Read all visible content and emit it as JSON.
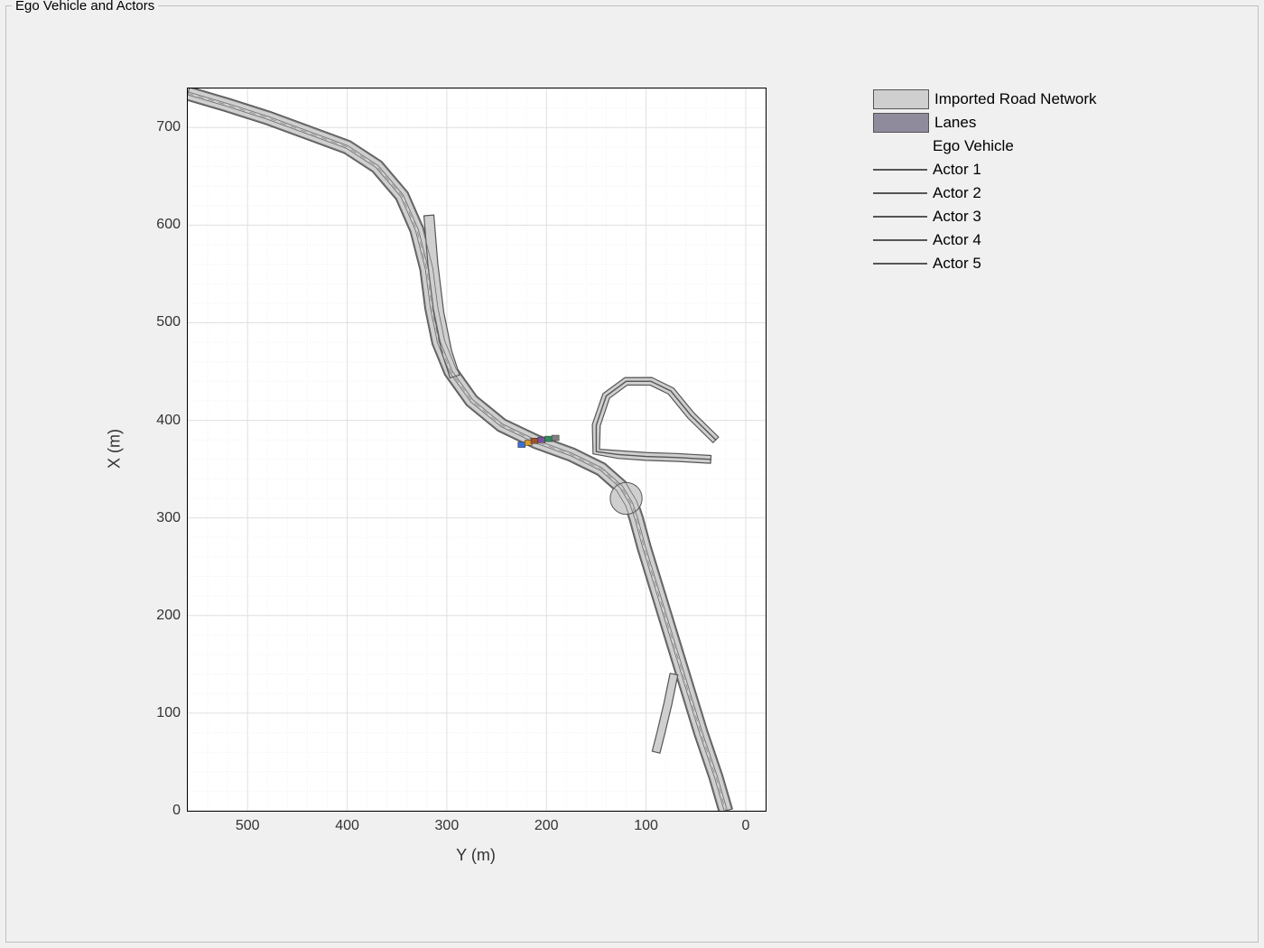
{
  "panel": {
    "title": "Ego Vehicle and Actors"
  },
  "axes": {
    "xlabel": "Y (m)",
    "ylabel": "X (m)",
    "x_ticks": [
      "500",
      "400",
      "300",
      "200",
      "100",
      "0"
    ],
    "y_ticks": [
      "0",
      "100",
      "200",
      "300",
      "400",
      "500",
      "600",
      "700"
    ],
    "x_range_data": [
      560,
      -20
    ],
    "y_range_data": [
      0,
      740
    ]
  },
  "legend": {
    "items": [
      {
        "kind": "swatch",
        "color": "#cfcfcf",
        "label": "Imported Road Network"
      },
      {
        "kind": "swatch",
        "color": "#8f8a9c",
        "label": "Lanes"
      },
      {
        "kind": "empty",
        "label": "Ego Vehicle"
      },
      {
        "kind": "line",
        "color": "#555555",
        "label": "Actor 1"
      },
      {
        "kind": "line",
        "color": "#555555",
        "label": "Actor 2"
      },
      {
        "kind": "line",
        "color": "#555555",
        "label": "Actor 3"
      },
      {
        "kind": "line",
        "color": "#555555",
        "label": "Actor 4"
      },
      {
        "kind": "line",
        "color": "#555555",
        "label": "Actor 5"
      }
    ]
  },
  "chart_data": {
    "type": "map",
    "title": "Ego Vehicle and Actors",
    "xlabel": "Y (m)",
    "ylabel": "X (m)",
    "x_range": [
      560,
      -20
    ],
    "y_range": [
      0,
      740
    ],
    "note": "Y axis (horizontal) is reversed (decreasing to the right).",
    "road_centerline_YX": [
      [
        560,
        735
      ],
      [
        520,
        723
      ],
      [
        480,
        710
      ],
      [
        440,
        695
      ],
      [
        400,
        680
      ],
      [
        370,
        660
      ],
      [
        345,
        630
      ],
      [
        330,
        595
      ],
      [
        320,
        555
      ],
      [
        315,
        515
      ],
      [
        308,
        480
      ],
      [
        296,
        450
      ],
      [
        275,
        420
      ],
      [
        245,
        395
      ],
      [
        210,
        378
      ],
      [
        175,
        365
      ],
      [
        145,
        350
      ],
      [
        125,
        332
      ],
      [
        115,
        315
      ],
      [
        110,
        300
      ],
      [
        102,
        270
      ],
      [
        90,
        230
      ],
      [
        75,
        180
      ],
      [
        60,
        130
      ],
      [
        45,
        80
      ],
      [
        30,
        35
      ],
      [
        20,
        0
      ]
    ],
    "road_width_m": 14,
    "side_road_YX": [
      [
        30,
        380
      ],
      [
        55,
        405
      ],
      [
        75,
        430
      ],
      [
        95,
        440
      ],
      [
        120,
        440
      ],
      [
        140,
        425
      ],
      [
        150,
        395
      ],
      [
        150,
        368
      ],
      [
        128,
        365
      ],
      [
        100,
        363
      ],
      [
        70,
        362
      ],
      [
        35,
        360
      ]
    ],
    "branch_road_YX": [
      [
        318,
        610
      ],
      [
        314,
        560
      ],
      [
        308,
        510
      ],
      [
        300,
        470
      ],
      [
        292,
        445
      ]
    ],
    "spur_road_YX": [
      [
        90,
        60
      ],
      [
        85,
        80
      ],
      [
        78,
        110
      ],
      [
        72,
        140
      ]
    ],
    "actor_markers_YX": [
      {
        "name": "Ego",
        "y": 225,
        "x": 375,
        "color": "#3b6fd6"
      },
      {
        "name": "Actor 1",
        "y": 218,
        "x": 377,
        "color": "#d69a2d"
      },
      {
        "name": "Actor 2",
        "y": 212,
        "x": 379,
        "color": "#a0522d"
      },
      {
        "name": "Actor 3",
        "y": 205,
        "x": 380,
        "color": "#7b4fa0"
      },
      {
        "name": "Actor 4",
        "y": 198,
        "x": 381,
        "color": "#2e8b57"
      },
      {
        "name": "Actor 5",
        "y": 191,
        "x": 382,
        "color": "#808080"
      }
    ],
    "intersection_center_YX": [
      120,
      320
    ]
  }
}
